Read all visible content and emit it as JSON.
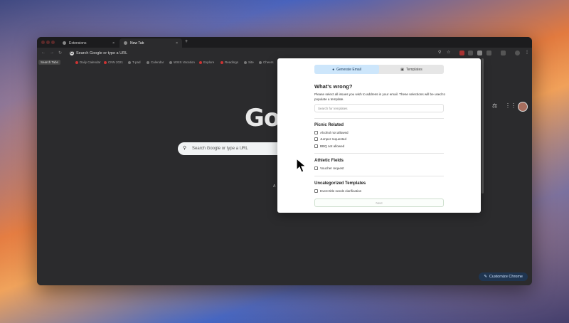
{
  "tabs": [
    {
      "label": "Extensions",
      "close": "×"
    },
    {
      "label": "New Tab",
      "close": "×"
    }
  ],
  "new_tab_symbol": "+",
  "omnibox": {
    "placeholder": "Search Google or type a URL"
  },
  "bookmarks": {
    "search_tabs": "Search Tabs",
    "items": [
      "Daily Calendar",
      "CNN 2021",
      "T-pad",
      "Calendar",
      "WSIS Vacation",
      "Explore",
      "Readings",
      "Site",
      "Cheers"
    ]
  },
  "newtab_page": {
    "logo": "Go",
    "search_placeholder": "Search Google or type a URL",
    "hint": "A",
    "customize_label": "Customize Chrome"
  },
  "popup": {
    "tabs": [
      {
        "label": "Generate Email",
        "icon": "lightbulb-icon",
        "active": true
      },
      {
        "label": "Templates",
        "icon": "template-icon",
        "active": false
      }
    ],
    "title": "What's wrong?",
    "description": "Please select all issues you wish to address in your email. These selections will be used to populate a template.",
    "search_placeholder": "Search for templates",
    "sections": [
      {
        "title": "Picnic Related",
        "items": [
          "Alcohol not allowed",
          "Jumper requested",
          "BBQ not allowed"
        ]
      },
      {
        "title": "Athletic Fields",
        "items": [
          "Voucher request"
        ]
      },
      {
        "title": "Uncategorized Templates",
        "items": [
          "Event title needs clarification"
        ]
      }
    ],
    "next_label": "Next"
  }
}
